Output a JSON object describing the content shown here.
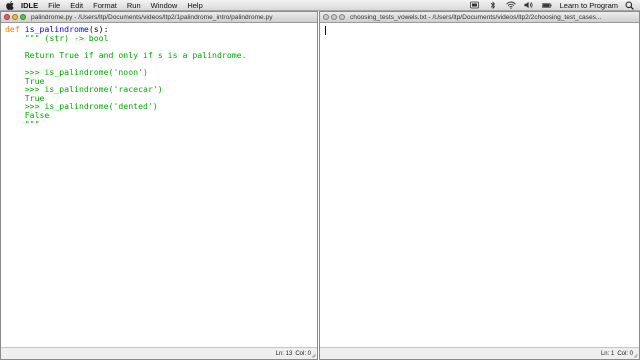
{
  "menubar": {
    "app_name": "IDLE",
    "items": [
      "File",
      "Edit",
      "Format",
      "Run",
      "Window",
      "Help"
    ],
    "user_name": "Learn to Program"
  },
  "left_window": {
    "title": "palindrome.py - /Users/ltp/Documents/videos/ltp2/1palindrome_intro/palindrome.py",
    "code": [
      {
        "spans": [
          {
            "t": "def ",
            "c": "kw"
          },
          {
            "t": "is_palindrome",
            "c": "def"
          },
          {
            "t": "(s):",
            "c": "plain"
          }
        ]
      },
      {
        "spans": [
          {
            "t": "    \"\"\" (str) -> bool",
            "c": "doc"
          }
        ]
      },
      {
        "spans": [
          {
            "t": "",
            "c": "doc"
          }
        ]
      },
      {
        "spans": [
          {
            "t": "    Return True if and only if s is a palindrome.",
            "c": "doc"
          }
        ]
      },
      {
        "spans": [
          {
            "t": "",
            "c": "doc"
          }
        ]
      },
      {
        "spans": [
          {
            "t": "    >>> is_palindrome('noon')",
            "c": "doc"
          }
        ]
      },
      {
        "spans": [
          {
            "t": "    True",
            "c": "doc"
          }
        ]
      },
      {
        "spans": [
          {
            "t": "    >>> is_palindrome('racecar')",
            "c": "doc"
          }
        ]
      },
      {
        "spans": [
          {
            "t": "    True",
            "c": "doc"
          }
        ]
      },
      {
        "spans": [
          {
            "t": "    >>> is_palindrome('dented')",
            "c": "doc"
          }
        ]
      },
      {
        "spans": [
          {
            "t": "    False",
            "c": "doc"
          }
        ]
      },
      {
        "spans": [
          {
            "t": "    \"\"\"",
            "c": "doc"
          }
        ]
      }
    ],
    "status_line": "Ln: 13",
    "status_col": "Col: 0"
  },
  "right_window": {
    "title": "choosing_tests_vowels.txt - /Users/ltp/Documents/videos/ltp2/2choosing_test_cases...",
    "status_line": "Ln: 1",
    "status_col": "Col: 0"
  },
  "colors": {
    "keyword": "#ff7700",
    "definition": "#0000ff",
    "docstring": "#00aa00"
  },
  "icons": [
    "apple-icon",
    "status-icon",
    "bluetooth-icon",
    "wifi-icon",
    "volume-icon",
    "battery-icon",
    "search-icon"
  ]
}
